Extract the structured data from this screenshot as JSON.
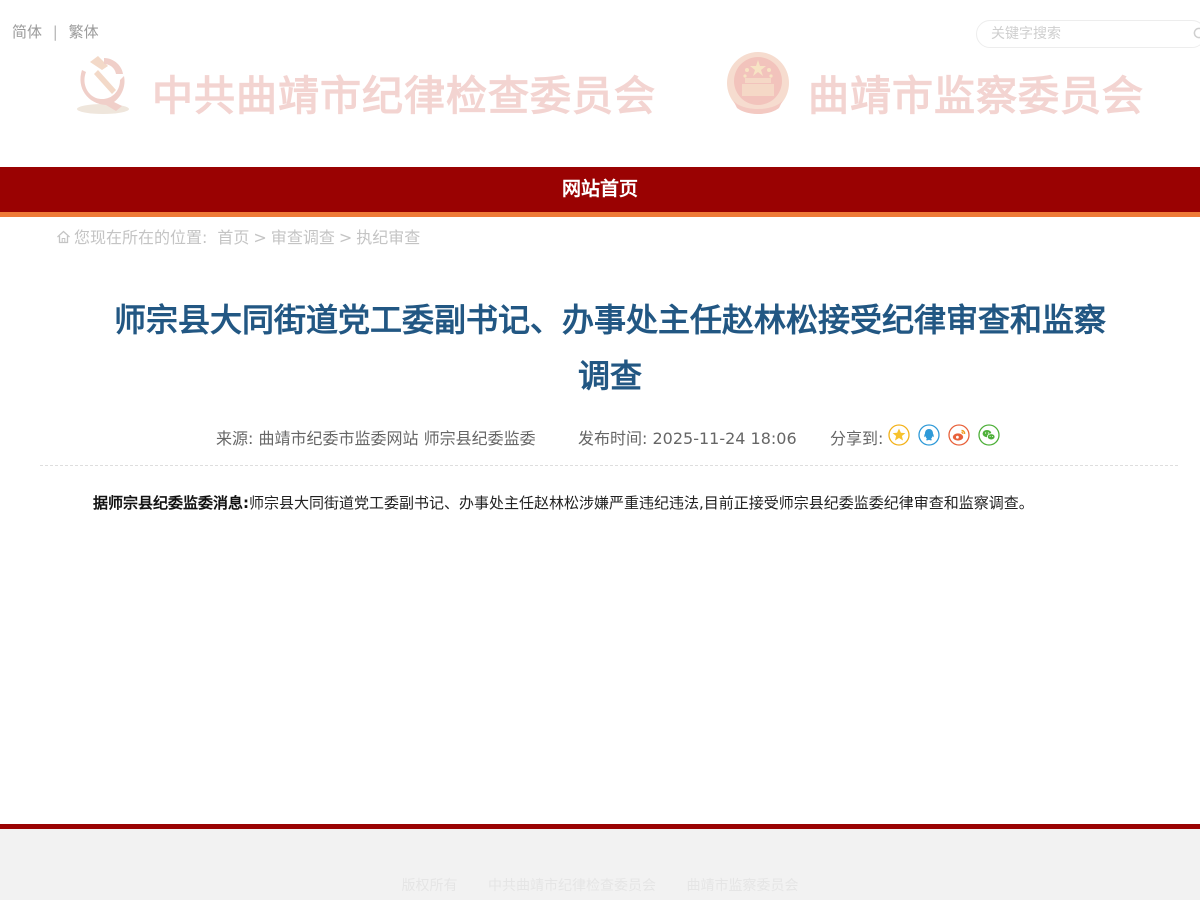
{
  "header": {
    "lang_simplified": "简体",
    "lang_separator": "|",
    "lang_traditional": "繁体",
    "search_placeholder": "关键字搜索",
    "title_left": "中共曲靖市纪律检查委员会",
    "title_right": "曲靖市监察委员会",
    "logo_left_icon": "party-emblem-icon",
    "logo_right_icon": "national-emblem-icon"
  },
  "nav": {
    "home": "网站首页"
  },
  "breadcrumb": {
    "prefix": "您现在所在的位置:",
    "items": [
      "首页",
      "审查调查",
      "执纪审查"
    ],
    "separator": ">"
  },
  "article": {
    "title": "师宗县大同街道党工委副书记、办事处主任赵林松接受纪律审查和监察调查",
    "source": "来源: 曲靖市纪委市监委网站 师宗县纪委监委",
    "time": "发布时间: 2025-11-24 18:06",
    "share_label": "分享到:",
    "share_icons": [
      "star-icon",
      "qq-icon",
      "weibo-icon",
      "wechat-icon"
    ],
    "lead": "据师宗县纪委监委消息:",
    "body": "师宗县大同街道党工委副书记、办事处主任赵林松涉嫌严重违纪违法,目前正接受师宗县纪委监委纪律审查和监察调查。"
  },
  "footer": {
    "items": [
      "版权所有",
      "中共曲靖市纪律检查委员会",
      "曲靖市监察委员会"
    ]
  },
  "colors": {
    "nav_red": "#9a0202",
    "nav_orange": "#ee7a37",
    "title_blue": "#225783",
    "footer_bg": "#f2f2f2"
  }
}
